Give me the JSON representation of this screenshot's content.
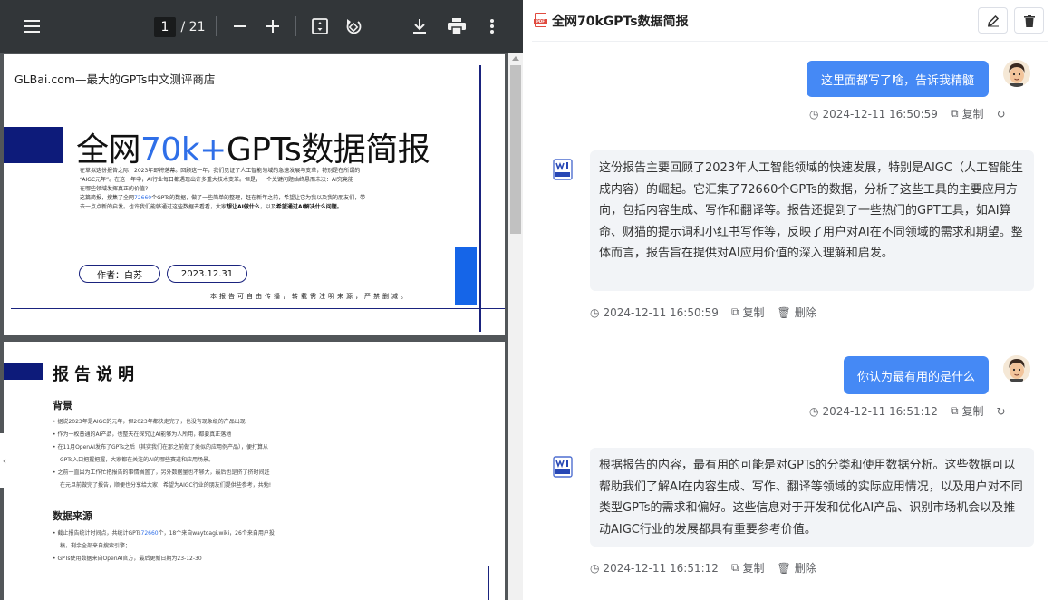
{
  "pdf_viewer": {
    "current_page": "1",
    "total_pages": "/ 21",
    "page1": {
      "header": "GLBai.com—最大的GPTs中文测评商店",
      "title_prefix": "全网",
      "title_highlight": "70k+",
      "title_suffix": "GPTs数据简报",
      "intro_lines": [
        "在草拟这份报告之际，2023年即将落幕。回顾这一年，我们见证了人工智能领域的急速发展与变革，特别是在所谓的",
        "“AIGC元年”。在这一年中，AI行业每日都遇现出许多重大技术变革。但是，一个关键问题始终悬而未决：AI究竟能",
        "在哪些领域发挥真正的价值?"
      ],
      "intro_line4_a": "这篇简报，搜集了全网",
      "intro_line4_num": "72660",
      "intro_line4_b": "个GPTs的数据，做了一些简单的整理，赶在新年之前，希望让它为我以及我的朋友们，带",
      "intro_line5_a": "去一点点新的启发。也许我们能够通过这些数据去看看，大家",
      "intro_line5_b1": "想让AI做什么",
      "intro_line5_c": "，以及",
      "intro_line5_b2": "希望通过AI解决什么问题。",
      "author": "作者：白苏",
      "date": "2023.12.31",
      "notice": "本报告可自由传播，转载需注明来源，严禁删减。"
    },
    "page2": {
      "title": "报告说明",
      "section1": "背景",
      "section1_items": [
        "• 据说2023年是AIGC的元年，但2023年都快走完了，也没有现象级的产品出现",
        "• 作为一枚普通的AI产品，也整天在探究让AI能够为人所用，都要真正落地",
        "• 在11月OpenAI发布了GPTs之后（其实我们在那之前做了类似的应用例产品），便打算从",
        "GPTs入口把握把握，大家都在关注的AI的哪些赛道和应用场景。",
        "• 之前一直因为工作忙把报告的事情搁置了，另外数据量也不够大，最后也是挤了挤时间赶",
        "在元旦前做完了报告，顺便也分享给大家，希望为AIGC行业的朋友们提供些参考，共勉!"
      ],
      "section2": "数据来源",
      "section2_item1_a": "• 截止报告统计时间点，共统计GPTs",
      "section2_item1_num": "72660",
      "section2_item1_b": "个，18个来自waytoagi.wiki，26个来自用户投",
      "section2_item2": "稿，剩余全部来自搜索引擎；",
      "section2_item3": "• GPTs使用数据来自OpenAI官方，最后更新日期为23-12-30"
    }
  },
  "chat": {
    "title": "全网70kGPTs数据简报",
    "messages": [
      {
        "role": "user",
        "text": "这里面都写了啥，告诉我精髓",
        "time": "2024-12-11 16:50:59",
        "copy": "复制"
      },
      {
        "role": "ai",
        "text": "这份报告主要回顾了2023年人工智能领域的快速发展，特别是AIGC（人工智能生成内容）的崛起。它汇集了72660个GPTs的数据，分析了这些工具的主要应用方向，包括内容生成、写作和翻译等。报告还提到了一些热门的GPT工具，如AI算命、财猫的提示词和小红书写作等，反映了用户对AI在不同领域的需求和期望。整体而言，报告旨在提供对AI应用价值的深入理解和启发。",
        "time": "2024-12-11 16:50:59",
        "copy": "复制",
        "delete": "删除"
      },
      {
        "role": "user",
        "text": "你认为最有用的是什么",
        "time": "2024-12-11 16:51:12",
        "copy": "复制"
      },
      {
        "role": "ai",
        "text": "根据报告的内容，最有用的可能是对GPTs的分类和使用数据分析。这些数据可以帮助我们了解AI在内容生成、写作、翻译等领域的实际应用情况，以及用户对不同类型GPTs的需求和偏好。这些信息对于开发和优化AI产品、识别市场机会以及推动AIGC行业的发展都具有重要参考价值。",
        "time": "2024-12-11 16:51:12",
        "copy": "复制",
        "delete": "删除"
      }
    ]
  },
  "icons": {
    "menu": "hamburger-menu-icon",
    "zoom_out": "minus-icon",
    "zoom_in": "plus-icon",
    "fit": "fit-to-page-icon",
    "rotate": "rotate-icon",
    "download": "download-icon",
    "print": "print-icon",
    "more": "more-vertical-icon",
    "clock": "clock-icon",
    "copy": "copy-icon",
    "refresh": "refresh-icon",
    "trash": "trash-icon",
    "edit": "edit-icon"
  },
  "colors": {
    "user_bubble": "#4589f5",
    "ai_bubble": "#f2f4f7",
    "pdf_toolbar": "#323639",
    "pdf_bg": "#525659",
    "accent_blue": "#2f6fe8",
    "navy": "#0d1b7a"
  }
}
